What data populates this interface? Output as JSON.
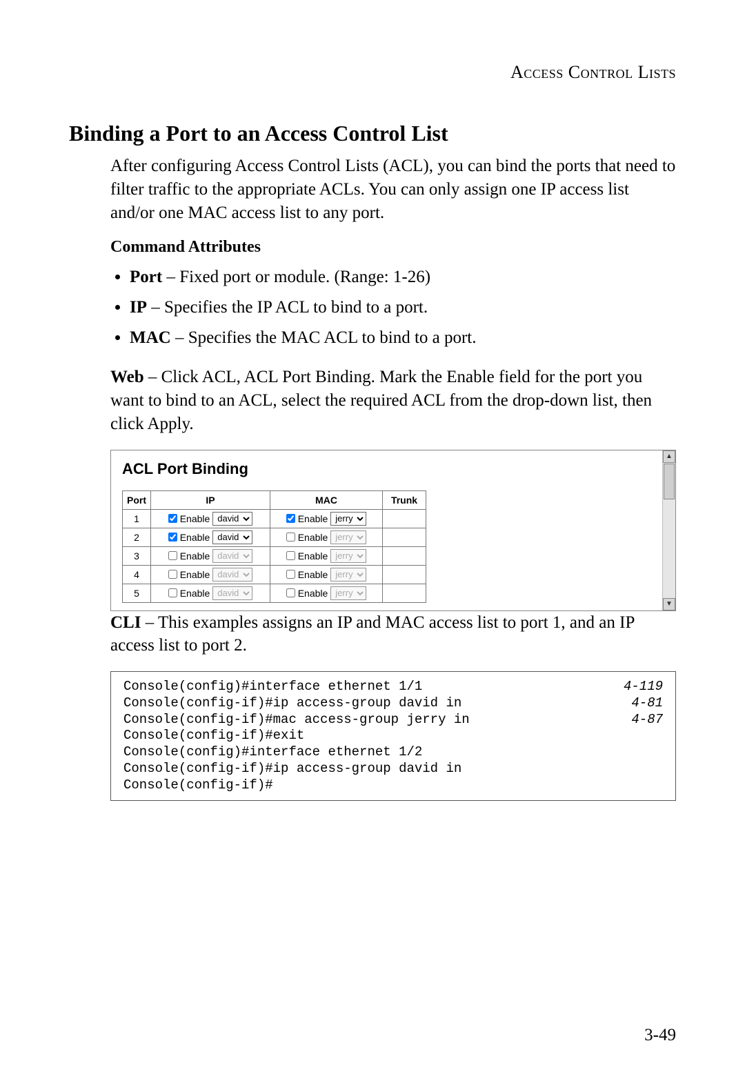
{
  "running_head": "Access Control Lists",
  "section_title": "Binding a Port to an Access Control List",
  "intro": "After configuring Access Control Lists (ACL), you can bind the ports that need to filter traffic to the appropriate ACLs. You can only assign one IP access list and/or one MAC access list to any port.",
  "command_attrs_heading": "Command Attributes",
  "attrs": [
    {
      "term": "Port",
      "desc": " – Fixed port or module. (Range: 1-26)"
    },
    {
      "term": "IP",
      "desc": " – Specifies the IP ACL to bind to a port."
    },
    {
      "term": "MAC",
      "desc": " – Specifies the MAC ACL to bind to a port."
    }
  ],
  "web_lead": "Web",
  "web_text": " – Click ACL, ACL Port Binding. Mark the Enable field for the port you want to bind to an ACL, select the required ACL from the drop-down list, then click Apply.",
  "panel": {
    "title": "ACL Port Binding",
    "enable_label": "Enable",
    "headers": {
      "port": "Port",
      "ip": "IP",
      "mac": "MAC",
      "trunk": "Trunk"
    },
    "ip_option": "david",
    "mac_option": "jerry",
    "rows": [
      {
        "port": "1",
        "ip_enabled": true,
        "mac_enabled": true,
        "trunk": ""
      },
      {
        "port": "2",
        "ip_enabled": true,
        "mac_enabled": false,
        "trunk": ""
      },
      {
        "port": "3",
        "ip_enabled": false,
        "mac_enabled": false,
        "trunk": ""
      },
      {
        "port": "4",
        "ip_enabled": false,
        "mac_enabled": false,
        "trunk": ""
      },
      {
        "port": "5",
        "ip_enabled": false,
        "mac_enabled": false,
        "trunk": ""
      }
    ]
  },
  "cli_lead": "CLI",
  "cli_text": " – This examples assigns an IP and MAC access list to port 1, and an IP access list to port 2.",
  "cli_lines": [
    {
      "cmd": "Console(config)#interface ethernet 1/1",
      "ref": "4-119"
    },
    {
      "cmd": "Console(config-if)#ip access-group david in",
      "ref": "4-81"
    },
    {
      "cmd": "Console(config-if)#mac access-group jerry in",
      "ref": "4-87"
    },
    {
      "cmd": "Console(config-if)#exit",
      "ref": ""
    },
    {
      "cmd": "Console(config)#interface ethernet 1/2",
      "ref": ""
    },
    {
      "cmd": "Console(config-if)#ip access-group david in",
      "ref": ""
    },
    {
      "cmd": "Console(config-if)#",
      "ref": ""
    }
  ],
  "page_number": "3-49"
}
